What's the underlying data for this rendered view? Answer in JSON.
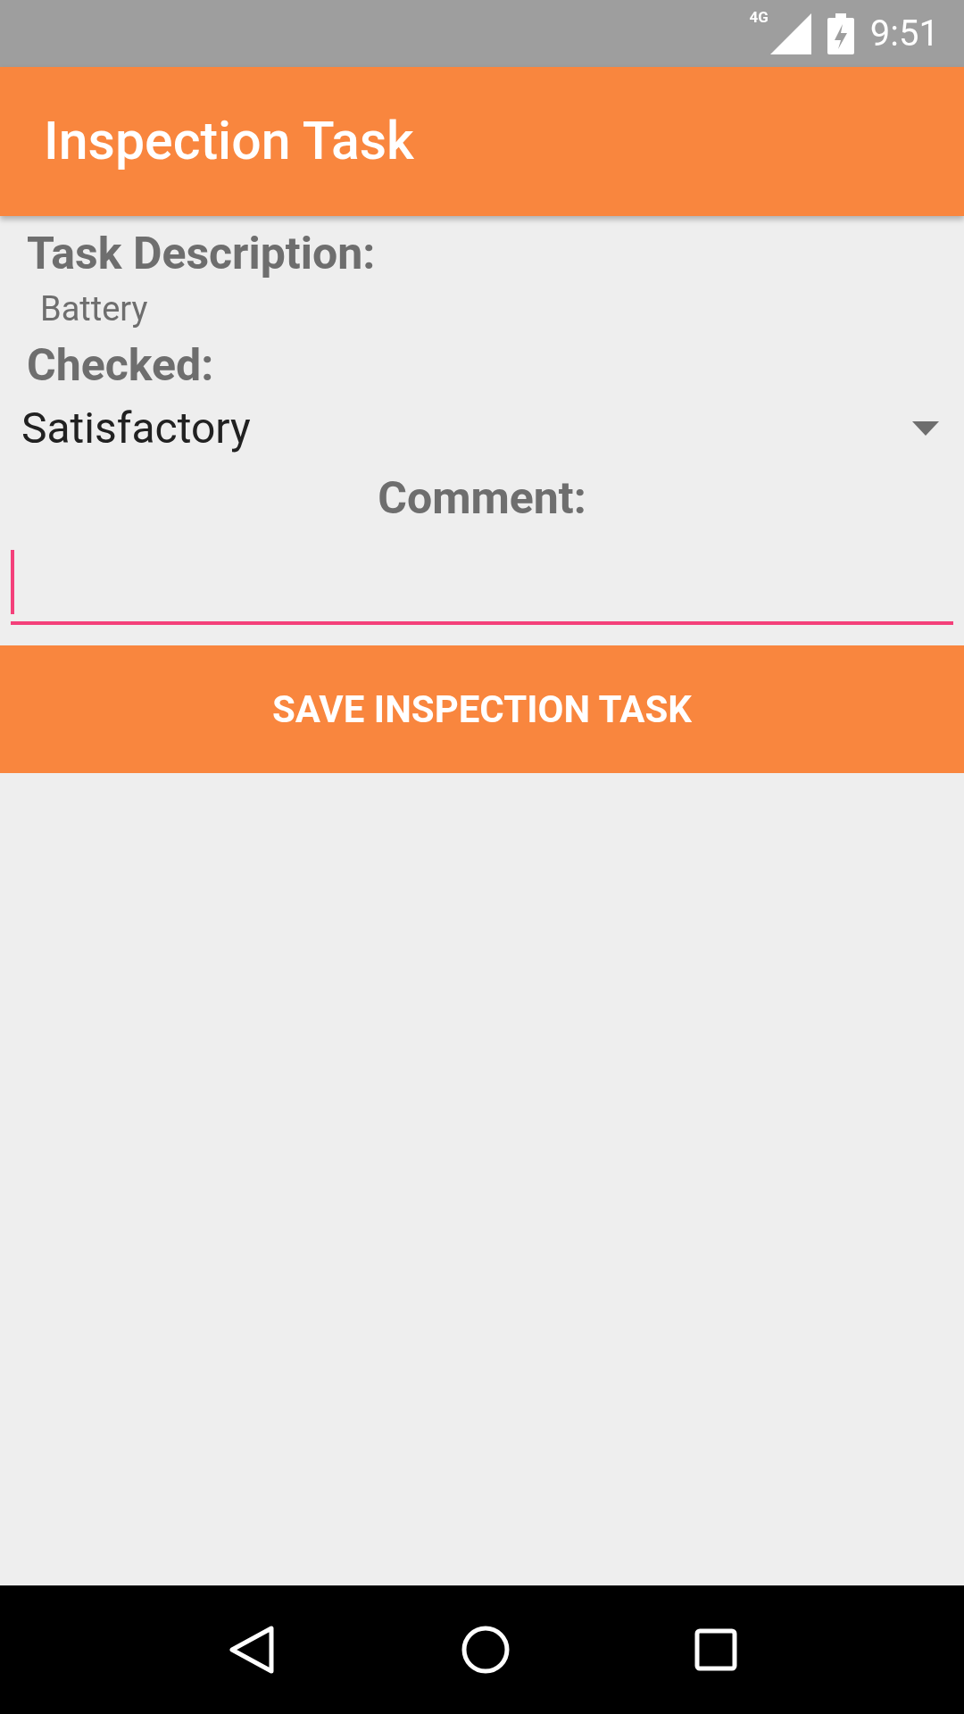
{
  "status_bar": {
    "network": "4G",
    "time": "9:51"
  },
  "app_bar": {
    "title": "Inspection Task"
  },
  "task_description": {
    "label": "Task Description:",
    "value": "Battery"
  },
  "checked": {
    "label": "Checked:",
    "value": "Satisfactory"
  },
  "comment": {
    "label": "Comment:",
    "focused": true
  },
  "save_button": {
    "label": "SAVE INSPECTION TASK"
  }
}
